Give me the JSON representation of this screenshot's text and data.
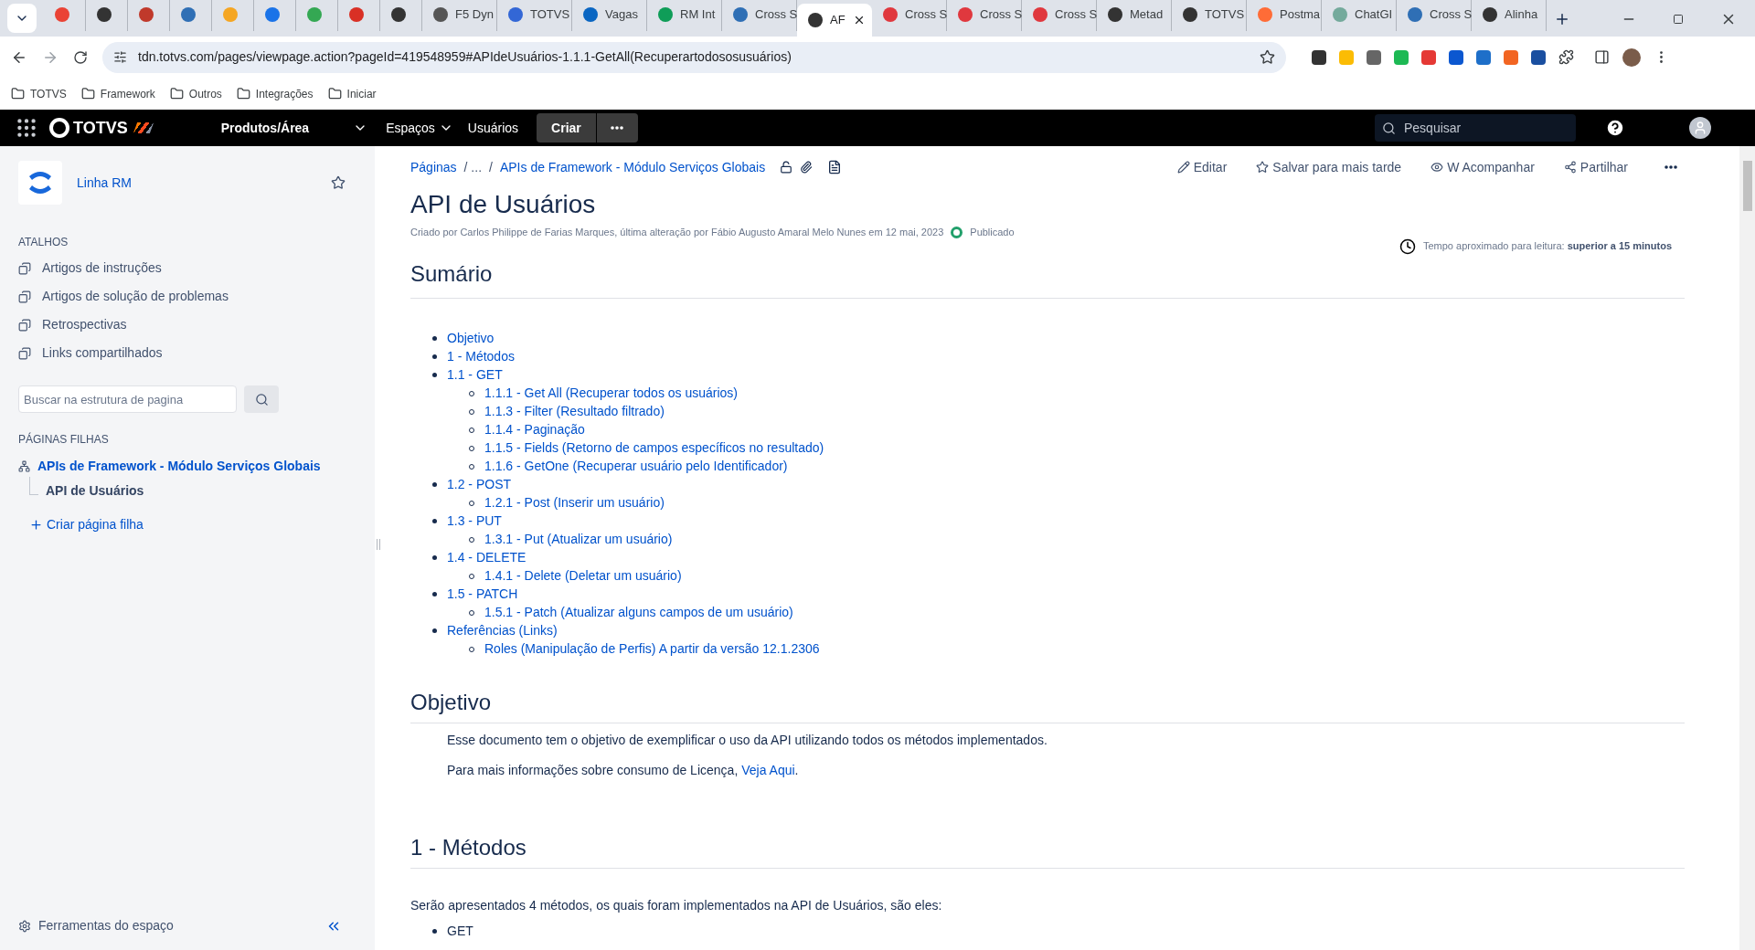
{
  "browser": {
    "tabs": [
      {
        "color": "#ea4335",
        "selected": false
      },
      {
        "color": "#333333",
        "selected": false
      },
      {
        "color": "#c0392b",
        "selected": false
      },
      {
        "color": "#2f6fb5",
        "selected": false
      },
      {
        "color": "#f5a623",
        "selected": false
      },
      {
        "color": "#1a73e8",
        "selected": false
      },
      {
        "color": "#34a853",
        "selected": false
      },
      {
        "color": "#d93025",
        "selected": false
      },
      {
        "color": "#333333",
        "selected": false
      },
      {
        "title": "F5 Dyn",
        "color": "#555555",
        "selected": false
      },
      {
        "title": "TOTVS",
        "color": "#3367d6",
        "selected": false
      },
      {
        "title": "Vagas",
        "color": "#0a66c2",
        "selected": false
      },
      {
        "title": "RM Int",
        "color": "#0f9d58",
        "selected": false
      },
      {
        "title": "Cross S",
        "color": "#2f6fb5",
        "selected": false
      },
      {
        "title": "AF",
        "color": "#333333",
        "selected": true
      },
      {
        "title": "Cross S",
        "color": "#e0383e",
        "selected": false
      },
      {
        "title": "Cross S",
        "color": "#e0383e",
        "selected": false
      },
      {
        "title": "Cross S",
        "color": "#e0383e",
        "selected": false
      },
      {
        "title": "Metad",
        "color": "#333333",
        "selected": false
      },
      {
        "title": "TOTVS",
        "color": "#333333",
        "selected": false
      },
      {
        "title": "Postma",
        "color": "#ff6c37",
        "selected": false
      },
      {
        "title": "ChatGI",
        "color": "#74aa9c",
        "selected": false
      },
      {
        "title": "Cross S",
        "color": "#2f6fb5",
        "selected": false
      },
      {
        "title": "Alinha",
        "color": "#333333",
        "selected": false
      }
    ],
    "address": "tdn.totvs.com/pages/viewpage.action?pageId=419548959#APIdeUsuários-1.1.1-GetAll(Recuperartodososusuários)",
    "bookmarks": [
      "TOTVS",
      "Framework",
      "Outros",
      "Integrações",
      "Iniciar"
    ]
  },
  "header": {
    "logo": "TOTVS",
    "nav": [
      {
        "label": "Produtos/Área",
        "kind": "dropdown-bold"
      },
      {
        "label": "Espaços",
        "kind": "dropdown"
      },
      {
        "label": "Usuários",
        "kind": "link"
      },
      {
        "label": "Criar",
        "kind": "button"
      }
    ],
    "search": {
      "placeholder": "Pesquisar"
    }
  },
  "sidebar": {
    "space_name": "Linha RM",
    "shortcuts_heading": "ATALHOS",
    "shortcuts": [
      "Artigos de instruções",
      "Artigos de solução de problemas",
      "Retrospectivas",
      "Links compartilhados"
    ],
    "search": {
      "placeholder": "Buscar na estrutura de pagina"
    },
    "children_heading": "PÁGINAS FILHAS",
    "tree": {
      "label": "APIs de Framework - Módulo Serviços Globais",
      "children": [
        {
          "label": "API de Usuários",
          "selected": true
        }
      ]
    },
    "create_child": "Criar página filha",
    "tools": "Ferramentas do espaço"
  },
  "page": {
    "breadcrumbs": [
      "Páginas",
      "/ ...",
      "/",
      "APIs de Framework - Módulo Serviços Globais"
    ],
    "actions": [
      {
        "label": "Editar",
        "kind": "edit"
      },
      {
        "label": "Salvar para mais tarde",
        "kind": "save"
      },
      {
        "label": "W Acompanhar",
        "kind": "watch"
      },
      {
        "label": "Partilhar",
        "kind": "share"
      }
    ],
    "title": "API de Usuários",
    "byline": "Criado por Carlos Philippe de Farias Marques, última alteração por Fábio Augusto Amaral Melo Nunes em 12 mai, 2023",
    "status": "Publicado",
    "reading_time": "Tempo aproximado para leitura: **superior a 15 minutos**",
    "toc_heading": "Sumário",
    "toc": [
      {
        "label": "Objetivo"
      },
      {
        "label": "1 - Métodos"
      },
      {
        "label": "1.1 - GET",
        "children": [
          "1.1.1 - Get All (Recuperar todos os usuários)",
          "1.1.3 - Filter (Resultado filtrado)",
          "1.1.4 - Paginação",
          "1.1.5 - Fields (Retorno de campos específicos no resultado)",
          "1.1.6 - GetOne (Recuperar usuário pelo Identificador)"
        ]
      },
      {
        "label": "1.2 - POST",
        "children": [
          "1.2.1 - Post (Inserir um usuário)"
        ]
      },
      {
        "label": "1.3 - PUT",
        "children": [
          "1.3.1 - Put (Atualizar um usuário)"
        ]
      },
      {
        "label": "1.4 - DELETE",
        "children": [
          "1.4.1 - Delete (Deletar um usuário)"
        ]
      },
      {
        "label": "1.5 - PATCH",
        "children": [
          "1.5.1 - Patch (Atualizar alguns campos de um usuário)"
        ]
      },
      {
        "label": "Referências (Links)",
        "children": [
          "Roles (Manipulação de Perfis) A partir da versão 12.1.2306"
        ]
      }
    ],
    "objective": {
      "heading": "Objetivo",
      "paragraph": "Esse documento tem o objetivo de exemplificar o uso da API utilizando todos os métodos implementados.",
      "license": {
        "text": "Para mais informações sobre consumo de Licença, ",
        "link": "Veja Aqui",
        "after": "."
      }
    },
    "methods": {
      "heading": "1 - Métodos",
      "paragraph": "Serão apresentados 4 métodos, os quais foram implementados na API de Usuários, são eles:",
      "items": [
        "GET"
      ]
    }
  }
}
